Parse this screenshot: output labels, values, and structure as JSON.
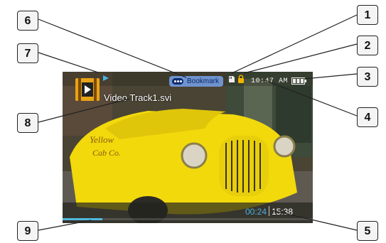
{
  "player": {
    "bookmark_label": "Bookmark",
    "clock": "10:47 AM",
    "track_title": "Video Track1.svi",
    "elapsed": "00:24",
    "total": "15:38",
    "progress_fraction": 0.16,
    "icons": [
      "video-file-icon",
      "play-icon",
      "bookmark-icon",
      "sd-card-icon",
      "lock-icon",
      "battery-icon"
    ],
    "colors": {
      "accent": "#50b8de",
      "bookmark_bg": "#6f93cf",
      "car_yellow": "#f2d90c"
    }
  },
  "callouts": [
    "1",
    "2",
    "3",
    "4",
    "5",
    "6",
    "7",
    "8",
    "9"
  ]
}
